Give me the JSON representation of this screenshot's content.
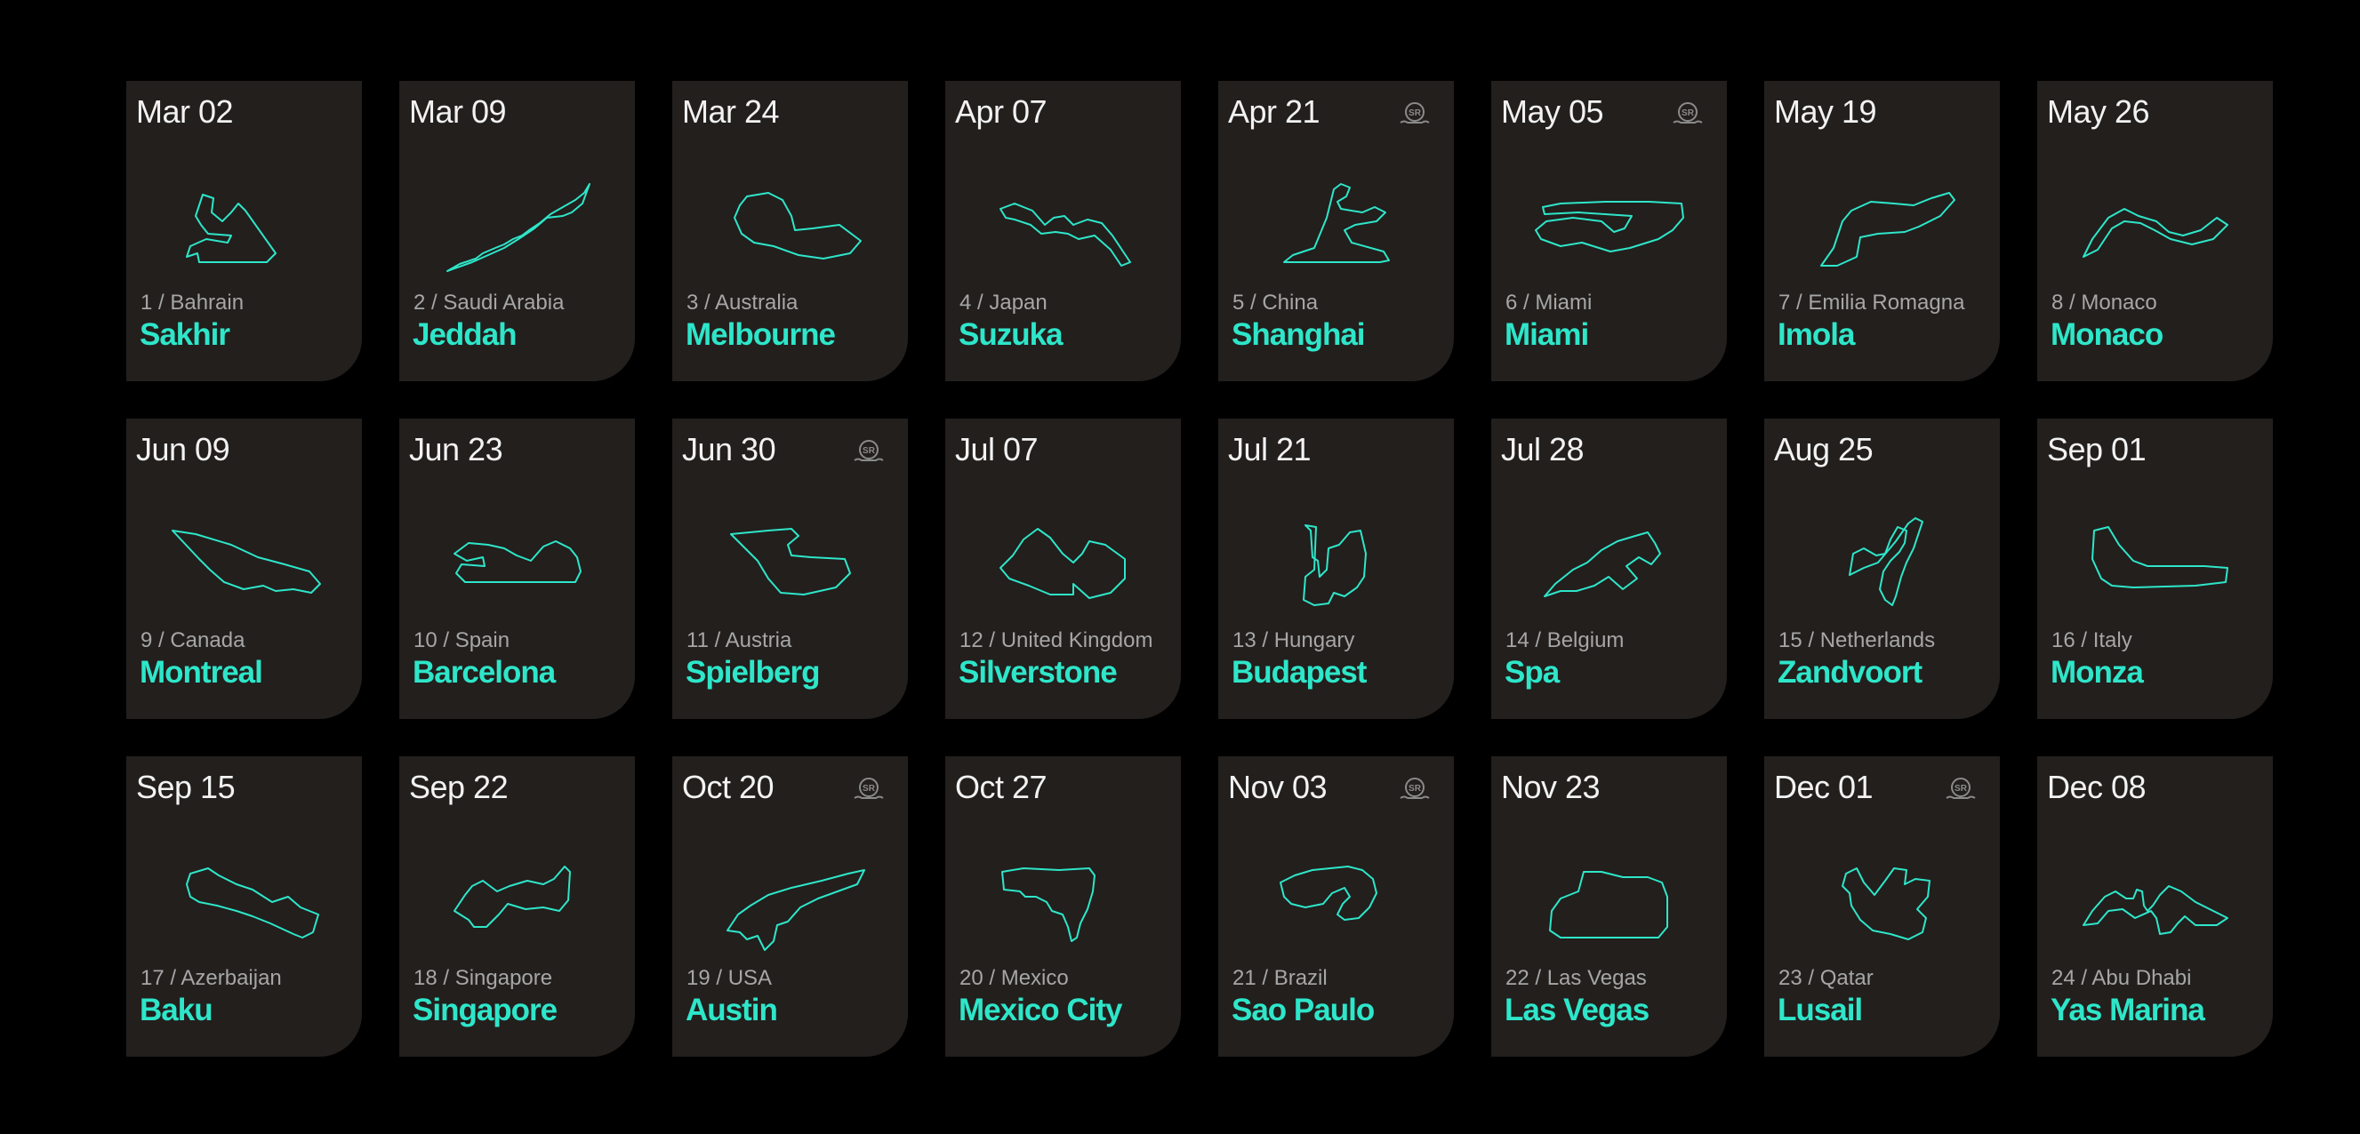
{
  "colors": {
    "background": "#000000",
    "card": "#221f1d",
    "accent": "#2ee6c9",
    "date_text": "#f2f2f2",
    "round_text": "#a6a6a6",
    "sprint_badge": "#8a8a8a"
  },
  "sprint_badge_label": "SR",
  "races": [
    {
      "date": "Mar 02",
      "round": "1 / Bahrain",
      "city": "Sakhir",
      "sprint": false,
      "icon": "sakhir-track-icon"
    },
    {
      "date": "Mar 09",
      "round": "2 / Saudi Arabia",
      "city": "Jeddah",
      "sprint": false,
      "icon": "jeddah-track-icon"
    },
    {
      "date": "Mar 24",
      "round": "3 / Australia",
      "city": "Melbourne",
      "sprint": false,
      "icon": "melbourne-track-icon"
    },
    {
      "date": "Apr 07",
      "round": "4 / Japan",
      "city": "Suzuka",
      "sprint": false,
      "icon": "suzuka-track-icon"
    },
    {
      "date": "Apr 21",
      "round": "5 / China",
      "city": "Shanghai",
      "sprint": true,
      "icon": "shanghai-track-icon"
    },
    {
      "date": "May 05",
      "round": "6 / Miami",
      "city": "Miami",
      "sprint": true,
      "icon": "miami-track-icon"
    },
    {
      "date": "May 19",
      "round": "7 / Emilia Romagna",
      "city": "Imola",
      "sprint": false,
      "icon": "imola-track-icon"
    },
    {
      "date": "May 26",
      "round": "8 / Monaco",
      "city": "Monaco",
      "sprint": false,
      "icon": "monaco-track-icon"
    },
    {
      "date": "Jun 09",
      "round": "9 / Canada",
      "city": "Montreal",
      "sprint": false,
      "icon": "montreal-track-icon"
    },
    {
      "date": "Jun 23",
      "round": "10 / Spain",
      "city": "Barcelona",
      "sprint": false,
      "icon": "barcelona-track-icon"
    },
    {
      "date": "Jun 30",
      "round": "11 / Austria",
      "city": "Spielberg",
      "sprint": true,
      "icon": "spielberg-track-icon"
    },
    {
      "date": "Jul 07",
      "round": "12 / United Kingdom",
      "city": "Silverstone",
      "sprint": false,
      "icon": "silverstone-track-icon"
    },
    {
      "date": "Jul 21",
      "round": "13 / Hungary",
      "city": "Budapest",
      "sprint": false,
      "icon": "budapest-track-icon"
    },
    {
      "date": "Jul 28",
      "round": "14 / Belgium",
      "city": "Spa",
      "sprint": false,
      "icon": "spa-track-icon"
    },
    {
      "date": "Aug 25",
      "round": "15 / Netherlands",
      "city": "Zandvoort",
      "sprint": false,
      "icon": "zandvoort-track-icon"
    },
    {
      "date": "Sep 01",
      "round": "16 / Italy",
      "city": "Monza",
      "sprint": false,
      "icon": "monza-track-icon"
    },
    {
      "date": "Sep 15",
      "round": "17 / Azerbaijan",
      "city": "Baku",
      "sprint": false,
      "icon": "baku-track-icon"
    },
    {
      "date": "Sep 22",
      "round": "18 / Singapore",
      "city": "Singapore",
      "sprint": false,
      "icon": "singapore-track-icon"
    },
    {
      "date": "Oct 20",
      "round": "19 / USA",
      "city": "Austin",
      "sprint": true,
      "icon": "austin-track-icon"
    },
    {
      "date": "Oct 27",
      "round": "20 / Mexico",
      "city": "Mexico City",
      "sprint": false,
      "icon": "mexico-city-track-icon"
    },
    {
      "date": "Nov 03",
      "round": "21 / Brazil",
      "city": "Sao Paulo",
      "sprint": true,
      "icon": "sao-paulo-track-icon"
    },
    {
      "date": "Nov 23",
      "round": "22 / Las Vegas",
      "city": "Las Vegas",
      "sprint": false,
      "icon": "las-vegas-track-icon"
    },
    {
      "date": "Dec 01",
      "round": "23 / Qatar",
      "city": "Lusail",
      "sprint": true,
      "icon": "lusail-track-icon"
    },
    {
      "date": "Dec 08",
      "round": "24 / Abu Dhabi",
      "city": "Yas Marina",
      "sprint": false,
      "icon": "yas-marina-track-icon"
    }
  ]
}
